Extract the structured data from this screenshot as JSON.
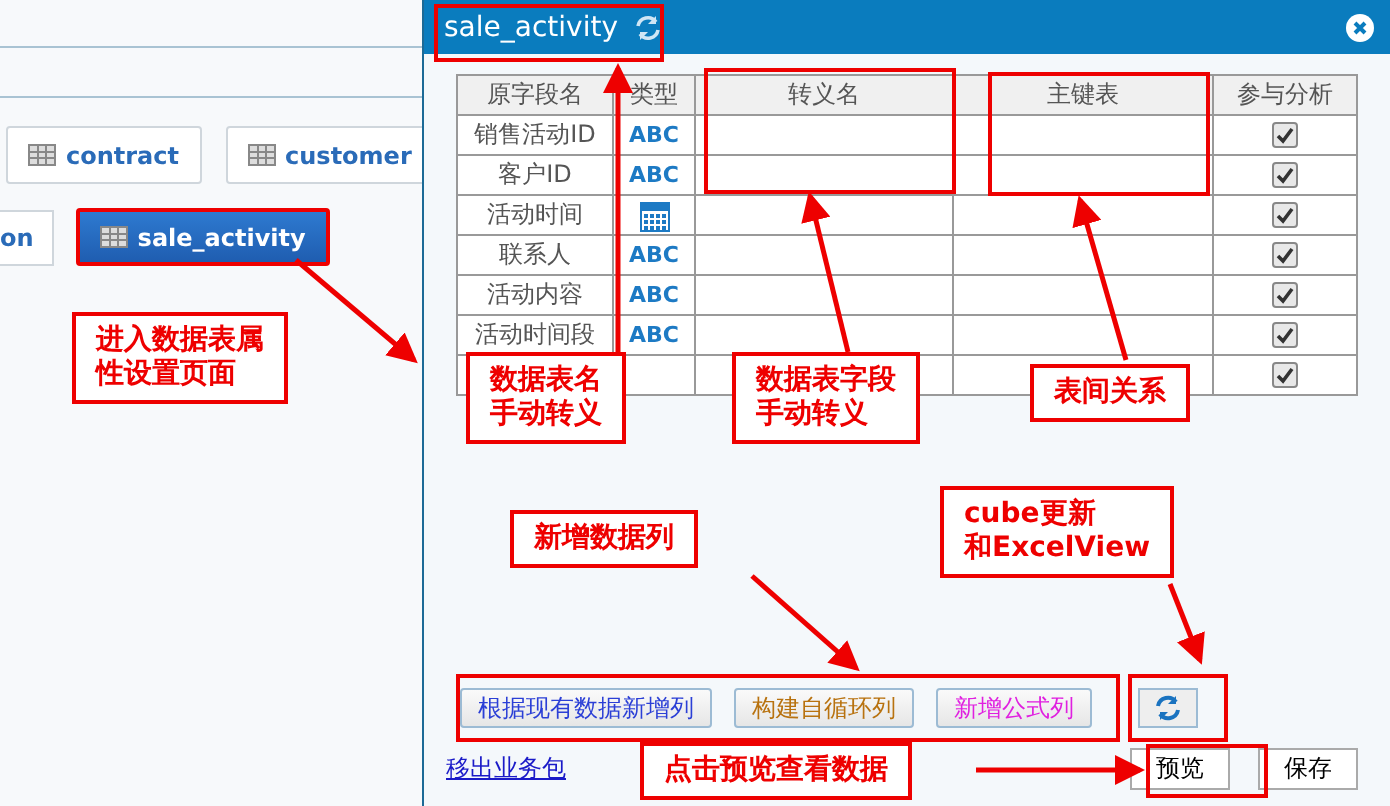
{
  "background": {
    "buttons": [
      {
        "label": "contract",
        "selected": false
      },
      {
        "label": "customer",
        "selected": false
      },
      {
        "label": "on",
        "selected": false
      },
      {
        "label": "sale_activity",
        "selected": true
      }
    ]
  },
  "dialog": {
    "title": "sale_activity",
    "columns": [
      "原字段名",
      "类型",
      "转义名",
      "主键表",
      "参与分析"
    ],
    "rows": [
      {
        "name": "销售活动ID",
        "kind": "text",
        "type_label": "ABC",
        "included": true
      },
      {
        "name": "客户ID",
        "kind": "text",
        "type_label": "ABC",
        "included": true
      },
      {
        "name": "活动时间",
        "kind": "date",
        "included": true
      },
      {
        "name": "联系人",
        "kind": "text",
        "type_label": "ABC",
        "included": true
      },
      {
        "name": "活动内容",
        "kind": "text",
        "type_label": "ABC",
        "included": true
      },
      {
        "name": "活动时间段",
        "kind": "text",
        "type_label": "ABC",
        "included": true
      },
      {
        "kind": "hidden",
        "included": true
      }
    ],
    "actions": [
      {
        "label": "根据现有数据新增列",
        "color": "#2b3fd6"
      },
      {
        "label": "构建自循环列",
        "color": "#b8720f"
      },
      {
        "label": "新增公式列",
        "color": "#e020e0"
      }
    ],
    "link": "移出业务包",
    "buttons": [
      "预览",
      "保存"
    ]
  },
  "annotations": [
    {
      "lines": [
        "进入数据表属",
        "性设置页面"
      ]
    },
    {
      "lines": [
        "数据表名",
        "手动转义"
      ]
    },
    {
      "lines": [
        "数据表字段",
        "手动转义"
      ]
    },
    {
      "lines": [
        "表间关系"
      ]
    },
    {
      "lines": [
        "新增数据列"
      ]
    },
    {
      "lines": [
        "cube更新",
        "和ExcelView"
      ]
    },
    {
      "lines": [
        "点击预览查看数据"
      ]
    }
  ]
}
